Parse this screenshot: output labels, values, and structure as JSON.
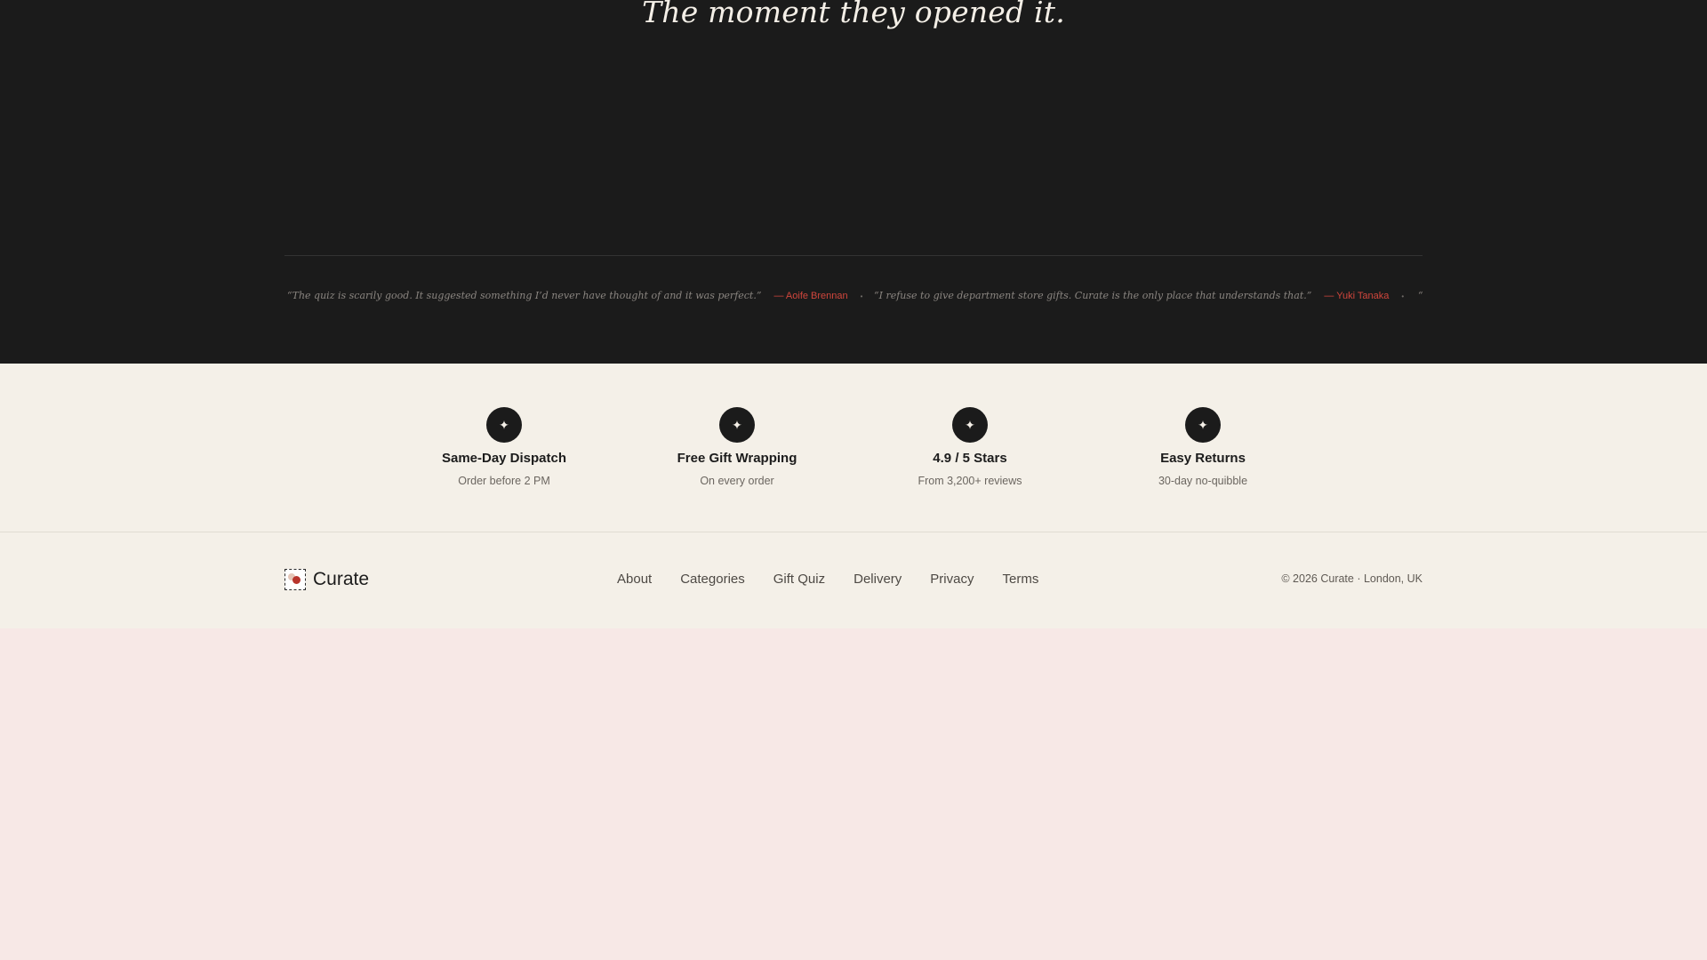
{
  "hero": {
    "headline": "The moment they opened it."
  },
  "testimonials": [
    {
      "quote": "“The quiz is scarily good. It suggested something I’d never have thought of and it was perfect.”",
      "author": "— Aoife Brennan"
    },
    {
      "quote": "“I refuse to give department store gifts. Curate is the only place that understands that.”",
      "author": "— Yuki Tanaka"
    },
    {
      "quote": "“",
      "author": ""
    }
  ],
  "features": [
    {
      "icon": "sparkle-icon",
      "title": "Same-Day Dispatch",
      "subtitle": "Order before 2 PM"
    },
    {
      "icon": "sparkle-icon",
      "title": "Free Gift Wrapping",
      "subtitle": "On every order"
    },
    {
      "icon": "sparkle-icon",
      "title": "4.9 / 5 Stars",
      "subtitle": "From 3,200+ reviews"
    },
    {
      "icon": "sparkle-icon",
      "title": "Easy Returns",
      "subtitle": "30-day no-quibble"
    }
  ],
  "footer": {
    "brand": "Curate",
    "nav": [
      "About",
      "Categories",
      "Gift Quiz",
      "Delivery",
      "Privacy",
      "Terms"
    ],
    "copyright": "© 2026 Curate · London, UK"
  },
  "colors": {
    "dark": "#1b1b1b",
    "cream": "#f4f0e8",
    "accent": "#d0463c",
    "blush": "#f7e8e6"
  }
}
